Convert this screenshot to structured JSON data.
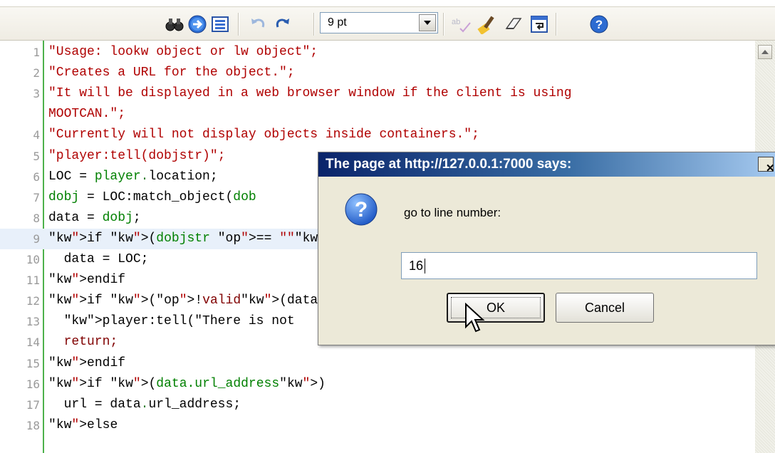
{
  "toolbar": {
    "font_size": "9 pt",
    "buttons": [
      "find-icon",
      "goto-icon",
      "select-all-icon",
      "undo-icon",
      "redo-icon",
      "spellcheck-icon",
      "highlight-icon",
      "eraser-icon",
      "wrap-icon",
      "help-icon"
    ]
  },
  "editor": {
    "rows": [
      {
        "num": "1",
        "code": "\"Usage: lookw object or lw object\";",
        "cls": "str"
      },
      {
        "num": "2",
        "code": "\"Creates a URL for the object.\";",
        "cls": "str"
      },
      {
        "num": "3",
        "code": "\"It will be displayed in a web browser window if the client is using",
        "cls": "str"
      },
      {
        "num": "",
        "code": "MOOTCAN.\";",
        "cls": "str"
      },
      {
        "num": "4",
        "code": "\"Currently will not display objects inside containers.\";",
        "cls": "str"
      },
      {
        "num": "5",
        "code": "\"player:tell(dobjstr)\";",
        "cls": "str"
      },
      {
        "num": "6",
        "code": "LOC = player.location;",
        "cls": "mix1"
      },
      {
        "num": "7",
        "code": "dobj = LOC:match_object(dob",
        "cls": "mix2"
      },
      {
        "num": "8",
        "code": "data = dobj;",
        "cls": "mix3"
      },
      {
        "num": "9",
        "code": "if (dobjstr == \"\")",
        "cls": "kw"
      },
      {
        "num": "10",
        "code": "  data = LOC;",
        "cls": ""
      },
      {
        "num": "11",
        "code": "endif",
        "cls": "kw"
      },
      {
        "num": "12",
        "code": "if (!valid(data))",
        "cls": "kw"
      },
      {
        "num": "13",
        "code": "  player:tell(\"There is not",
        "cls": "mix4"
      },
      {
        "num": "14",
        "code": "  return;",
        "cls": "fn"
      },
      {
        "num": "15",
        "code": "endif",
        "cls": "kw"
      },
      {
        "num": "16",
        "code": "if (data.url_address)",
        "cls": "kw"
      },
      {
        "num": "17",
        "code": "  url = data.url_address;",
        "cls": ""
      },
      {
        "num": "18",
        "code": "else",
        "cls": "kw"
      }
    ]
  },
  "dialog": {
    "title": "The page at http://127.0.0.1:7000 says:",
    "prompt": "go to line number:",
    "input_value": "16",
    "ok_label": "OK",
    "cancel_label": "Cancel",
    "close_glyph": "✕"
  }
}
